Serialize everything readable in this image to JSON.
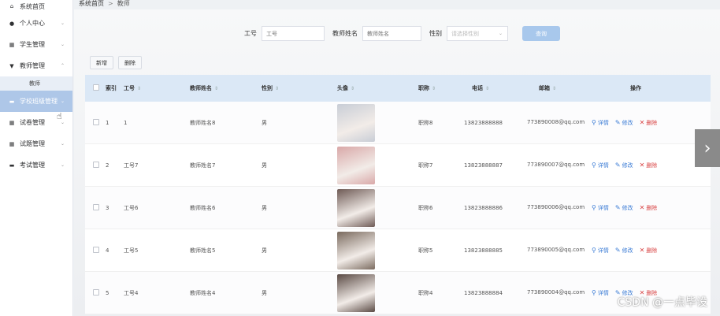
{
  "sidebar": {
    "items": [
      {
        "label": "系统首页",
        "icon": "home-icon",
        "glyph": "⌂",
        "chevron": false
      },
      {
        "label": "个人中心",
        "icon": "user-icon",
        "glyph": "●",
        "chevron": true
      },
      {
        "label": "学生管理",
        "icon": "grid-icon",
        "glyph": "▦",
        "chevron": true
      },
      {
        "label": "教师管理",
        "icon": "teacher-icon",
        "glyph": "▼",
        "chevron": true,
        "expanded": true
      },
      {
        "label": "教师",
        "sub": true
      },
      {
        "label": "学校班级管理",
        "icon": "monitor-icon",
        "glyph": "▬",
        "chevron": true,
        "active": true
      },
      {
        "label": "试卷管理",
        "icon": "grid-icon",
        "glyph": "▦",
        "chevron": true
      },
      {
        "label": "试题管理",
        "icon": "table-icon",
        "glyph": "▦",
        "chevron": true
      },
      {
        "label": "考试管理",
        "icon": "monitor-icon",
        "glyph": "▬",
        "chevron": true
      }
    ]
  },
  "breadcrumb": {
    "home": "系统首页",
    "separator": ">",
    "current": "教师"
  },
  "search": {
    "label_no": "工号",
    "placeholder_no": "工号",
    "label_name": "教师姓名",
    "placeholder_name": "教师姓名",
    "label_sex": "性别",
    "placeholder_sex": "请选择性别",
    "query_label": "查询"
  },
  "toolbar": {
    "add_label": "新增",
    "delete_label": "删除"
  },
  "table": {
    "headers": {
      "index": "索引",
      "no": "工号",
      "name": "教师姓名",
      "sex": "性别",
      "avatar": "头像",
      "title": "职称",
      "phone": "电话",
      "mail": "邮箱",
      "ops": "操作"
    },
    "op_labels": {
      "detail": "详情",
      "edit": "修改",
      "delete": "删除"
    },
    "rows": [
      {
        "idx": "1",
        "no": "1",
        "name": "教师姓名8",
        "sex": "男",
        "title": "职称8",
        "phone": "13823888888",
        "mail": "773890008@qq.com",
        "avatar_color": "#c8cdd6"
      },
      {
        "idx": "2",
        "no": "工号7",
        "name": "教师姓名7",
        "sex": "男",
        "title": "职称7",
        "phone": "13823888887",
        "mail": "773890007@qq.com",
        "avatar_color": "#d9a8a8"
      },
      {
        "idx": "3",
        "no": "工号6",
        "name": "教师姓名6",
        "sex": "男",
        "title": "职称6",
        "phone": "13823888886",
        "mail": "773890006@qq.com",
        "avatar_color": "#6e5a55"
      },
      {
        "idx": "4",
        "no": "工号5",
        "name": "教师姓名5",
        "sex": "男",
        "title": "职称5",
        "phone": "13823888885",
        "mail": "773890005@qq.com",
        "avatar_color": "#7a6a5e"
      },
      {
        "idx": "5",
        "no": "工号4",
        "name": "教师姓名4",
        "sex": "男",
        "title": "职称4",
        "phone": "13823888884",
        "mail": "773890004@qq.com",
        "avatar_color": "#5a4a44"
      }
    ]
  },
  "colors": {
    "accent": "#a8c8ec",
    "active_menu": "#aec7e8",
    "header_bg": "#dbe8f6",
    "link": "#3a7bd5",
    "danger": "#d94545"
  },
  "watermark": "CSDN @一点毕设"
}
